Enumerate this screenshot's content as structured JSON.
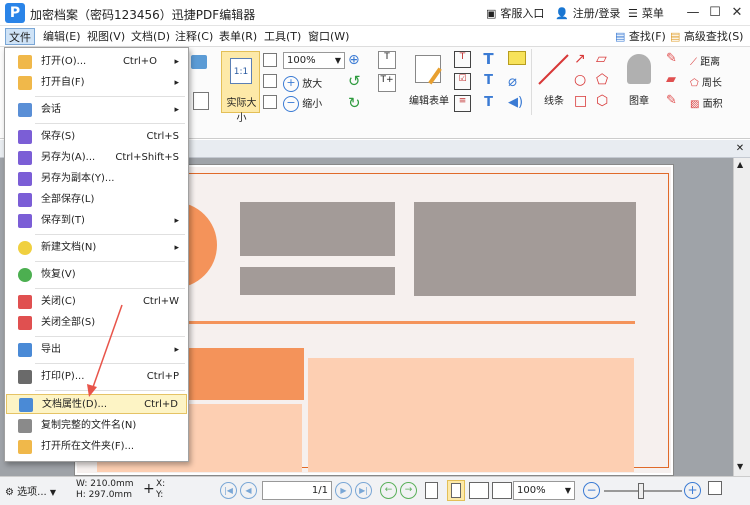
{
  "window": {
    "title": "加密档案（密码123456）迅捷PDF编辑器",
    "logo": "P",
    "service": "客服入口",
    "login": "注册/登录",
    "menu": "菜单",
    "min": "—",
    "max": "☐",
    "close": "✕"
  },
  "menubar": [
    "文件",
    "编辑(E)",
    "视图(V)",
    "文档(D)",
    "注释(C)",
    "表单(R)",
    "工具(T)",
    "窗口(W)"
  ],
  "menubar_right": {
    "find": "查找(F)",
    "advanced_find": "高级查找(S)"
  },
  "ribbon": {
    "actual_size": "实际大小",
    "actual_size_icon": "1:1",
    "zoom_value": "100%",
    "zoom_in": "放大",
    "zoom_out": "缩小",
    "edit_form": "编辑表单",
    "line": "线条",
    "stamp": "图章",
    "distance": "距离",
    "perimeter": "周长",
    "area": "面积"
  },
  "file_menu": [
    {
      "label": "打开(O)...",
      "shortcut": "Ctrl+O",
      "arrow": "▸",
      "color": "#f0b84a"
    },
    {
      "label": "打开自(F)",
      "shortcut": "",
      "arrow": "▸",
      "color": "#f0b84a"
    },
    {
      "label": "会话",
      "shortcut": "",
      "arrow": "▸",
      "color": "#5a8fd6"
    },
    {
      "label": "保存(S)",
      "shortcut": "Ctrl+S",
      "arrow": "",
      "color": "#7b5ed6"
    },
    {
      "label": "另存为(A)...",
      "shortcut": "Ctrl+Shift+S",
      "arrow": "",
      "color": "#7b5ed6"
    },
    {
      "label": "另存为副本(Y)...",
      "shortcut": "",
      "arrow": "",
      "color": "#7b5ed6"
    },
    {
      "label": "全部保存(L)",
      "shortcut": "",
      "arrow": "",
      "color": "#7b5ed6"
    },
    {
      "label": "保存到(T)",
      "shortcut": "",
      "arrow": "▸",
      "color": "#7b5ed6"
    },
    {
      "label": "新建文档(N)",
      "shortcut": "",
      "arrow": "▸",
      "color": "#f0d040"
    },
    {
      "label": "恢复(V)",
      "shortcut": "",
      "arrow": "",
      "color": "#4caf50"
    },
    {
      "label": "关闭(C)",
      "shortcut": "Ctrl+W",
      "arrow": "",
      "color": "#e05050"
    },
    {
      "label": "关闭全部(S)",
      "shortcut": "",
      "arrow": "",
      "color": "#e05050"
    },
    {
      "label": "导出",
      "shortcut": "",
      "arrow": "▸",
      "color": "#4a8ad6"
    },
    {
      "label": "打印(P)...",
      "shortcut": "Ctrl+P",
      "arrow": "",
      "color": "#6a6a6a"
    },
    {
      "label": "文档属性(D)...",
      "shortcut": "Ctrl+D",
      "arrow": "",
      "color": "#4a8ad6"
    },
    {
      "label": "复制完整的文件名(N)",
      "shortcut": "",
      "arrow": "",
      "color": "#8a8a8a"
    },
    {
      "label": "打开所在文件夹(F)...",
      "shortcut": "",
      "arrow": "",
      "color": "#f0b84a"
    }
  ],
  "status": {
    "options": "选项...",
    "w": "W: 210.0mm",
    "h": "H: 297.0mm",
    "x": "X:",
    "y": "Y:",
    "page": "1/1",
    "zoom": "100%"
  },
  "colors": {
    "accent": "#2a84e8",
    "highlight": "#fdf4c5",
    "orange": "#f4935a",
    "peach": "#fdcfb2",
    "gray_block": "#a39b98",
    "arrow": "#e8544a"
  }
}
